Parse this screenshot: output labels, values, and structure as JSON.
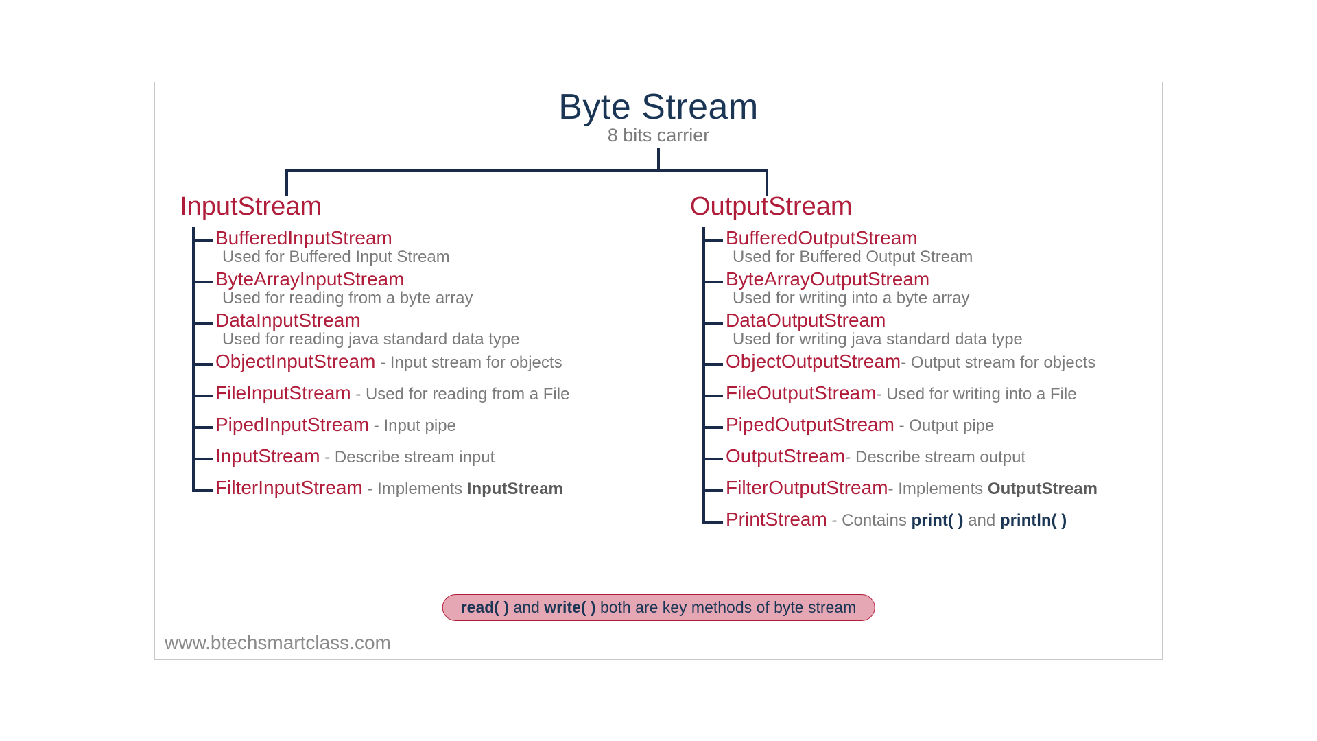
{
  "title": "Byte Stream",
  "subtitle": "8 bits carrier",
  "left": {
    "heading": "InputStream",
    "items": [
      {
        "name": "BufferedInputStream",
        "desc": "Used for Buffered Input Stream",
        "inline": false
      },
      {
        "name": "ByteArrayInputStream",
        "desc": "Used for reading from a byte array",
        "inline": false
      },
      {
        "name": "DataInputStream",
        "desc": "Used for reading java standard data type",
        "inline": false
      },
      {
        "name": "ObjectInputStream",
        "sep": "  - ",
        "desc": "Input stream for objects",
        "inline": true
      },
      {
        "name": "FileInputStream",
        "sep": " - ",
        "desc": "Used for reading from a File",
        "inline": true
      },
      {
        "name": "PipedInputStream",
        "sep": " - ",
        "desc": "Input pipe",
        "inline": true
      },
      {
        "name": "InputStream",
        "sep": "  - ",
        "desc": "Describe stream input",
        "inline": true
      },
      {
        "name": "FilterInputStream",
        "sep": "  - ",
        "desc_pre": "Implements ",
        "desc_strong": "InputStream",
        "inline": true
      }
    ]
  },
  "right": {
    "heading": "OutputStream",
    "items": [
      {
        "name": "BufferedOutputStream",
        "desc": "Used for Buffered Output Stream",
        "inline": false
      },
      {
        "name": "ByteArrayOutputStream",
        "desc": "Used for writing into a byte array",
        "inline": false
      },
      {
        "name": "DataOutputStream",
        "desc": "Used for writing java standard data type",
        "inline": false
      },
      {
        "name": "ObjectOutputStream",
        "sep": "- ",
        "desc": "Output stream for objects",
        "inline": true
      },
      {
        "name": "FileOutputStream",
        "sep": "- ",
        "desc": "Used for writing into a File",
        "inline": true
      },
      {
        "name": "PipedOutputStream",
        "sep": " - ",
        "desc": "Output pipe",
        "inline": true
      },
      {
        "name": "OutputStream",
        "sep": "- ",
        "s": true,
        "desc": "Describe stream output",
        "inline": true
      },
      {
        "name": "FilterOutputStream",
        "sep": "- ",
        "desc_pre": "Implements ",
        "desc_strong": "OutputStream",
        "inline": true
      },
      {
        "name": "PrintStream",
        "sep": "   - ",
        "desc_pre": "Contains ",
        "desc_blue1": "print( )",
        "desc_mid": " and ",
        "desc_blue2": "println( )",
        "inline": true
      }
    ]
  },
  "footer": {
    "m1": "read( )",
    "t1": " and ",
    "m2": "write( )",
    "t2": " both are key methods of byte stream"
  },
  "url": "www.btechsmartclass.com"
}
